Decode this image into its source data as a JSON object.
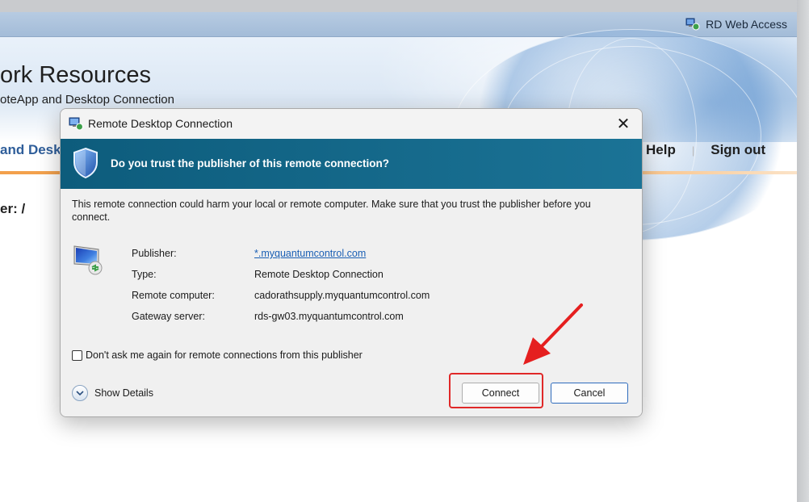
{
  "browser": {
    "header_link": "RD Web Access"
  },
  "site": {
    "title": "ork Resources",
    "subtitle": "oteApp and Desktop Connection",
    "nav_left": "and Desk",
    "nav_help": "Help",
    "nav_sep": "|",
    "nav_signout": "Sign out",
    "page_label": "er: /"
  },
  "dialog": {
    "title": "Remote Desktop Connection",
    "close_glyph": "✕",
    "warning": "Do you trust the publisher of this remote connection?",
    "description": "This remote connection could harm your local or remote computer. Make sure that you trust the publisher before you connect.",
    "fields": [
      {
        "label": "Publisher:",
        "value": "*.myquantumcontrol.com"
      },
      {
        "label": "Type:",
        "value": "Remote Desktop Connection"
      },
      {
        "label": "Remote computer:",
        "value": "cadorathsupply.myquantumcontrol.com"
      },
      {
        "label": "Gateway server:",
        "value": "rds-gw03.myquantumcontrol.com"
      }
    ],
    "checkbox_label": "Don't ask me again for remote connections from this publisher",
    "checkbox_checked": false,
    "show_details": "Show Details",
    "connect": "Connect",
    "cancel": "Cancel"
  },
  "colors": {
    "warning_band": "#0d5c7c",
    "accent_orange": "#f3a04b",
    "highlight_red": "#e02828",
    "link_blue": "#1a5fb4"
  },
  "icons": {
    "rdwa": "remote-desktop-icon",
    "title": "remote-desktop-icon",
    "shield": "shield-icon",
    "monitor": "monitor-icon",
    "chevron": "chevron-down-icon",
    "arrow": "arrow-icon"
  }
}
